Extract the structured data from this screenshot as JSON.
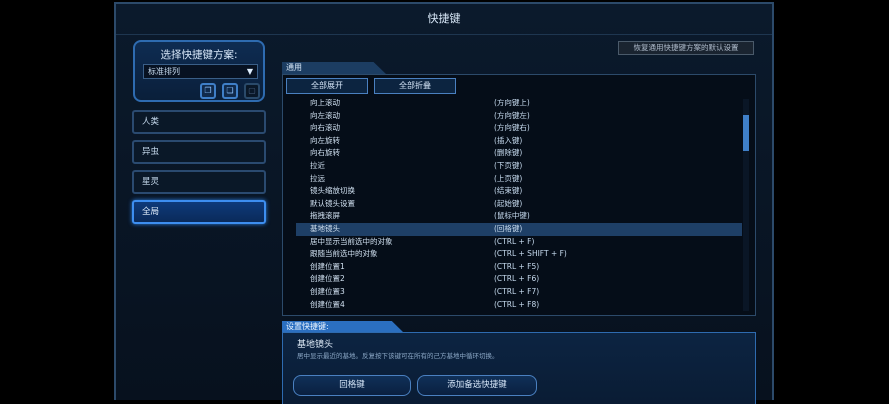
{
  "window": {
    "title": "快捷键"
  },
  "scheme": {
    "title": "选择快捷键方案:",
    "selected": "标准排列",
    "icons": [
      "copy-scheme-icon",
      "paste-scheme-icon",
      "lock-scheme-icon"
    ]
  },
  "races": [
    {
      "label": "人类",
      "active": false
    },
    {
      "label": "异虫",
      "active": false
    },
    {
      "label": "星灵",
      "active": false
    },
    {
      "label": "全局",
      "active": true
    }
  ],
  "reset_label": "恢复通用快捷键方案的默认设置",
  "section_tab": "通用",
  "toolbar": {
    "expand_label": "全部展开",
    "collapse_label": "全部折叠"
  },
  "hotkeys": [
    {
      "name": "向上滚动",
      "key": "(方向键上)"
    },
    {
      "name": "向左滚动",
      "key": "(方向键左)"
    },
    {
      "name": "向右滚动",
      "key": "(方向键右)"
    },
    {
      "name": "向左旋转",
      "key": "(插入键)"
    },
    {
      "name": "向右旋转",
      "key": "(删除键)"
    },
    {
      "name": "拉近",
      "key": "(下页键)"
    },
    {
      "name": "拉远",
      "key": "(上页键)"
    },
    {
      "name": "镜头缩放切换",
      "key": "(结束键)"
    },
    {
      "name": "默认镜头设置",
      "key": "(起始键)"
    },
    {
      "name": "拖拽滚屏",
      "key": "(鼠标中键)"
    },
    {
      "name": "基地镜头",
      "key": "(回格键)",
      "selected": true
    },
    {
      "name": "居中显示当前选中的对象",
      "key": "(CTRL + F)"
    },
    {
      "name": "跟随当前选中的对象",
      "key": "(CTRL + SHIFT + F)"
    },
    {
      "name": "创建位置1",
      "key": "(CTRL + F5)"
    },
    {
      "name": "创建位置2",
      "key": "(CTRL + F6)"
    },
    {
      "name": "创建位置3",
      "key": "(CTRL + F7)"
    },
    {
      "name": "创建位置4",
      "key": "(CTRL + F8)"
    }
  ],
  "settings": {
    "tab_label": "设置快捷键:",
    "hotkey_name": "基地镜头",
    "description": "居中显示最近的基地。反复按下该键可在所有的己方基地中循环切换。",
    "primary_label": "回格键",
    "alternate_label": "添加备选快捷键"
  }
}
